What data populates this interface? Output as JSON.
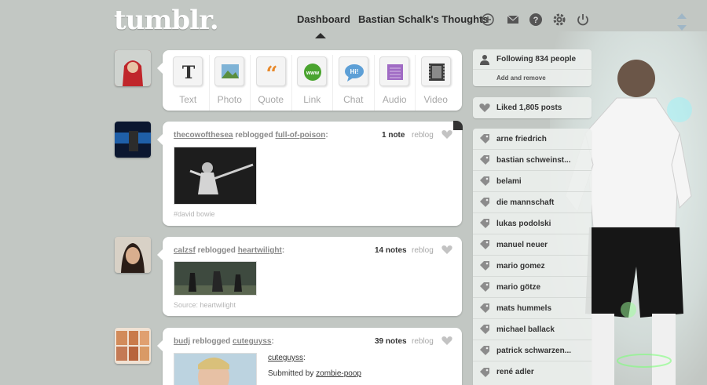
{
  "header": {
    "logo": "tumblr.",
    "nav": [
      "Dashboard",
      "Bastian Schalk's Thoughts"
    ],
    "icons": [
      "plus-icon",
      "mail-icon",
      "help-icon",
      "gear-icon",
      "power-icon"
    ]
  },
  "composer": {
    "items": [
      {
        "label": "Text",
        "icon": "text-icon"
      },
      {
        "label": "Photo",
        "icon": "photo-icon"
      },
      {
        "label": "Quote",
        "icon": "quote-icon"
      },
      {
        "label": "Link",
        "icon": "link-icon",
        "icon_text": "www"
      },
      {
        "label": "Chat",
        "icon": "chat-icon",
        "icon_text": "Hi!"
      },
      {
        "label": "Audio",
        "icon": "audio-icon"
      },
      {
        "label": "Video",
        "icon": "video-icon"
      }
    ]
  },
  "posts": [
    {
      "user": "thecowofthesea",
      "verb": "reblogged",
      "source": "full-of-poison",
      "notes": "1 note",
      "reblog": "reblog",
      "tag": "#david bowie"
    },
    {
      "user": "calzsf",
      "verb": "reblogged",
      "source": "heartwilight",
      "notes": "14 notes",
      "reblog": "reblog",
      "tag": "Source: heartwilight"
    },
    {
      "user": "budj",
      "verb": "reblogged",
      "source": "cuteguyss",
      "notes": "39 notes",
      "reblog": "reblog",
      "caption_link": "cuteguyss",
      "caption_prefix": "Submitted by ",
      "caption_user": "zombie-poop"
    }
  ],
  "sidebar": {
    "following": "Following 834 people",
    "add_remove": "Add and remove",
    "liked": "Liked 1,805 posts",
    "people": [
      "arne friedrich",
      "bastian schweinst...",
      "belami",
      "die mannschaft",
      "lukas podolski",
      "manuel neuer",
      "mario gomez",
      "mario götze",
      "mats hummels",
      "michael ballack",
      "patrick schwarzen...",
      "rené adler"
    ]
  },
  "colors": {
    "background": "#c2c7c3",
    "card": "#ffffff",
    "accent": "#529ecc"
  }
}
